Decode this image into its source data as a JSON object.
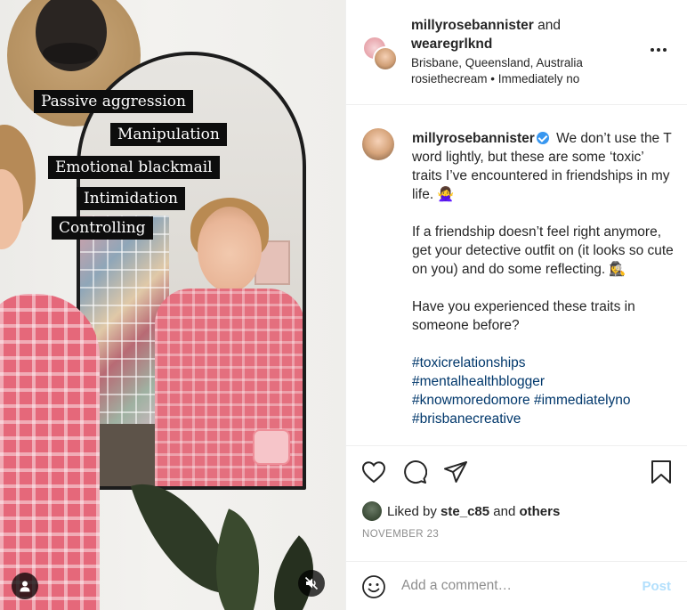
{
  "media": {
    "text_overlays": [
      "Passive aggression",
      "Manipulation",
      "Emotional blackmail",
      "Intimidation",
      "Controlling"
    ],
    "icons": {
      "user_tag": "person-icon",
      "mute": "speaker-muted-icon"
    }
  },
  "header": {
    "user1": "millyrosebannister",
    "joiner": "and",
    "user2": "wearegrlknd",
    "location": "Brisbane, Queensland, Australia",
    "audio": "rosiethecream • Immediately no",
    "more_icon": "more-options-icon"
  },
  "caption": {
    "username": "millyrosebannister",
    "verified": true,
    "para1": "We don’t use the T word lightly, but these are some ‘toxic’ traits I’ve encountered in friendships in my life. 🙅‍♀️",
    "para2": "If a friendship doesn’t feel right anymore, get your detective outfit on (it looks so cute on you) and do some reflecting. 🕵️‍♀️",
    "para3": "Have you experienced these traits in someone before?",
    "hashtags": [
      "#toxicrelationships",
      "#mentalhealthblogger",
      "#knowmoredomore #immediatelyno",
      "#brisbanecreative"
    ]
  },
  "actions": {
    "like_icon": "heart-icon",
    "comment_icon": "comment-bubble-icon",
    "share_icon": "paper-plane-icon",
    "save_icon": "bookmark-icon"
  },
  "likes": {
    "prefix": "Liked by",
    "user": "ste_c85",
    "joiner": "and",
    "others": "others"
  },
  "date": "NOVEMBER 23",
  "comment": {
    "placeholder": "Add a comment…",
    "post_label": "Post",
    "emoji_icon": "smiley-icon"
  },
  "colors": {
    "hashtag": "#00376b",
    "verified": "#3897f0",
    "post_button_disabled": "#b2dffc",
    "muted_text": "#8e8e8e"
  }
}
